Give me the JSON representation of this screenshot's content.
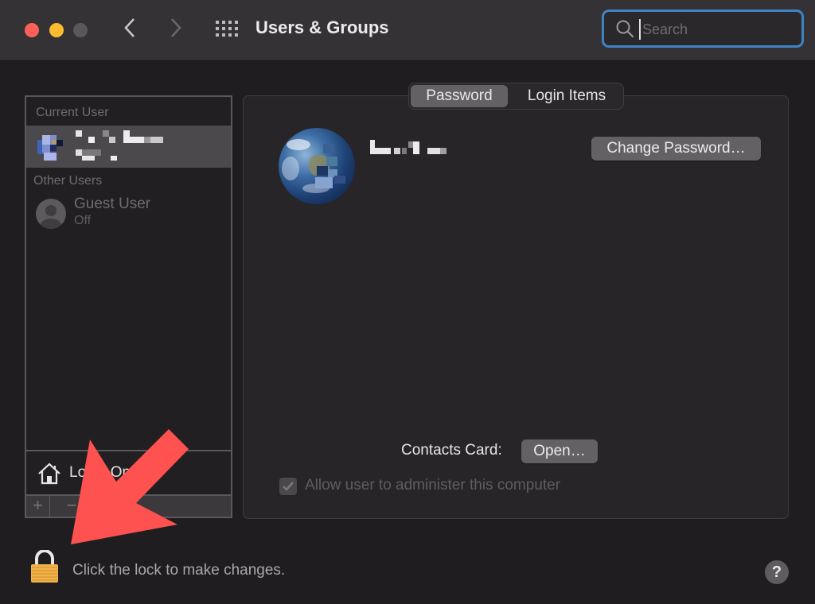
{
  "window": {
    "title": "Users & Groups",
    "traffic_lights": {
      "close": "#fe5f57",
      "minimize": "#febc2e",
      "maximize": "#5a585b"
    },
    "nav_back_icon": "chevron-left-icon",
    "nav_forward_icon": "chevron-right-icon",
    "show_all_icon": "grid-icon"
  },
  "search": {
    "placeholder": "Search",
    "value": "",
    "focus_color": "#3e84c4"
  },
  "sidebar": {
    "current_user_label": "Current User",
    "current_user_name": "(pixelated)",
    "other_users_label": "Other Users",
    "other_users": [
      {
        "name": "Guest User",
        "status": "Off"
      }
    ],
    "login_options_label": "Login Options",
    "add_label": "+",
    "remove_label": "−"
  },
  "tabs": [
    {
      "label": "Password",
      "selected": true
    },
    {
      "label": "Login Items",
      "selected": false
    }
  ],
  "main": {
    "user_full_name": "(pixelated)",
    "change_password_label": "Change Password…",
    "contacts_card_label": "Contacts Card:",
    "open_label": "Open…",
    "admin_checkbox_label": "Allow user to administer this computer",
    "admin_checked": true,
    "admin_enabled": false
  },
  "footer": {
    "lock_text": "Click the lock to make changes.",
    "lock_state": "unlocked",
    "help_label": "?"
  },
  "annotation": {
    "type": "arrow",
    "color": "#fd5250",
    "points_to": "lock-icon"
  }
}
